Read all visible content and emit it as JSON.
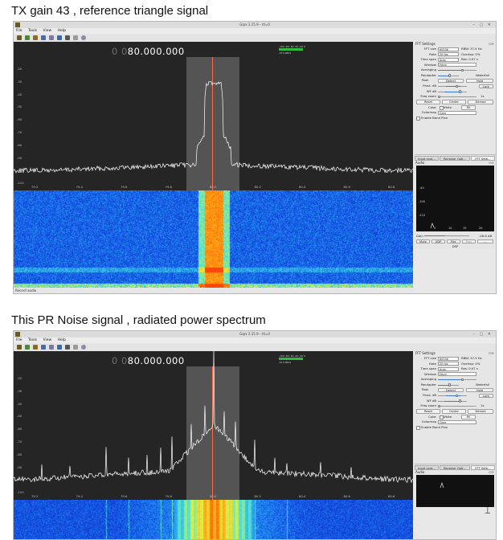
{
  "captions": {
    "top": "TX gain 43 , reference  triangle signal",
    "bottom": "This PR Noise signal , radiated power spectrum"
  },
  "window": {
    "title": "Gqrx 2.15.9 - rtl=0",
    "menu": [
      "File",
      "Tools",
      "View",
      "Help"
    ],
    "controls": "– ▢ ✕",
    "toolbar_icons": [
      "power-icon",
      "open-folder-icon",
      "folder-icon",
      "save-icon",
      "network-icon",
      "display-icon",
      "record-icon",
      "tools-icon",
      "settings-icon"
    ]
  },
  "receiver": {
    "freq_dim": "0 0",
    "freq_main": "80.000.000",
    "smeter_scale": "-100 -80 -60 -40 -20 0",
    "smeter_readout": "-67.5 dBFS",
    "y_axis_labels": [
      "-20",
      "-30",
      "-40",
      "-50",
      "-60",
      "-70",
      "-80",
      "-90",
      "-100",
      "-110"
    ],
    "x_axis_labels": [
      "79.2",
      "79.4",
      "79.6",
      "79.8",
      "80.0",
      "80.2",
      "80.4",
      "80.6",
      "80.8"
    ],
    "status": "Record audio"
  },
  "fft_panel": {
    "title": "FFT Settings",
    "fft_size_label": "FFT size",
    "fft_size": "65536",
    "rbw": "RBW: 37.5 Hz",
    "rate_label": "Rate",
    "rate": "25 fps",
    "overlap": "Overlap: 0%",
    "time_span_label": "Time span",
    "time_span": "Auto",
    "res": "Res: 0.07 s",
    "window_label": "Window",
    "window": "Hann",
    "averaging_label": "Averaging",
    "pandapter_label": "Pandapter",
    "waterfall_label": "Waterfall",
    "peak_label": "Peak",
    "detect_btn": "Detect",
    "hold_btn": "Hold",
    "pand_db_label": "Pand. dB",
    "lock_btn": "Lock",
    "wf_db_label": "WF dB",
    "freq_zoom_label": "Freq zoom",
    "freq_zoom_value": "1x",
    "reset_btn": "Reset",
    "center_btn": "Center",
    "demod_btn": "Demod",
    "color_label": "Color",
    "white_label": "White",
    "fill_btn": "Fill",
    "colormap_label": "Colormap",
    "colormap": "Gqrx",
    "enable_band_plan": "Enable Band Plan",
    "tabs": [
      "Input cont...",
      "Receiver Opti...",
      "FFT Setti..."
    ]
  },
  "audio_panel": {
    "title": "Audio",
    "y_labels": [
      "-40",
      "-100",
      "-110"
    ],
    "x_labels": [
      "5",
      "10",
      "15",
      "20"
    ],
    "gain_label": "Gain",
    "gain_value": "-26.6 dB",
    "buttons": [
      "Mute",
      "UDP",
      "Rec",
      "Play",
      "..."
    ],
    "dsp_label": "DSP"
  },
  "colors": {
    "accent_blue": "#3a7bd5",
    "plot_bg": "#252525",
    "trace": "#ffffff",
    "marker": "#ff6a4d",
    "meter_green": "#2dbb3d"
  }
}
